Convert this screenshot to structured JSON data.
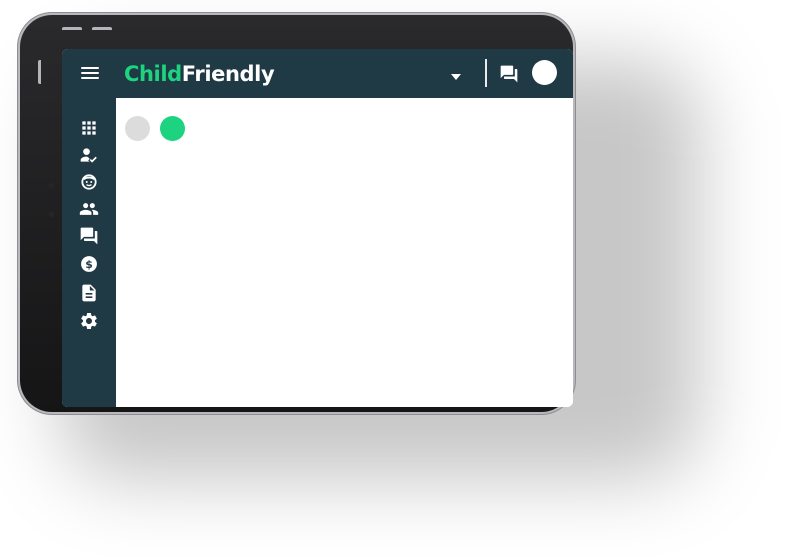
{
  "app": {
    "brand_part_a": "Child",
    "brand_part_b": "Friendly",
    "accent_color": "#1ed37f",
    "sidebar_color": "#1f3a44"
  },
  "header": {
    "menu_icon": "hamburger-icon",
    "dropdown_icon": "caret-down-icon",
    "chat_icon": "chat-icon",
    "avatar_icon": "avatar"
  },
  "sidebar": {
    "items": [
      {
        "icon": "apps-grid-icon"
      },
      {
        "icon": "person-check-icon"
      },
      {
        "icon": "child-face-icon"
      },
      {
        "icon": "people-icon"
      },
      {
        "icon": "messages-icon"
      },
      {
        "icon": "dollar-icon"
      },
      {
        "icon": "document-icon"
      },
      {
        "icon": "settings-gear-icon"
      }
    ]
  },
  "main": {
    "toggle_dots": [
      {
        "state": "inactive",
        "color": "#dcdcdc"
      },
      {
        "state": "active",
        "color": "#1ed37f"
      }
    ]
  }
}
